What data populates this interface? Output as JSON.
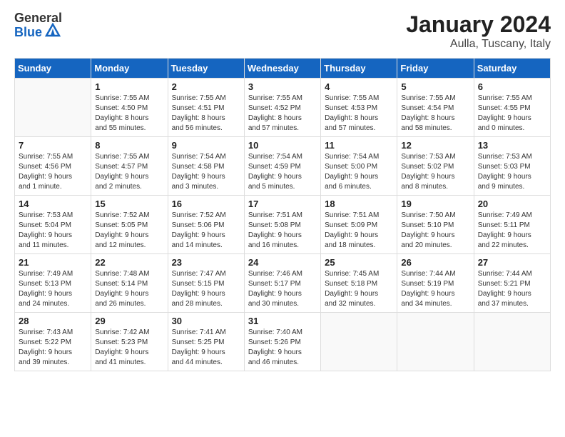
{
  "logo": {
    "general": "General",
    "blue": "Blue"
  },
  "title": "January 2024",
  "location": "Aulla, Tuscany, Italy",
  "headers": [
    "Sunday",
    "Monday",
    "Tuesday",
    "Wednesday",
    "Thursday",
    "Friday",
    "Saturday"
  ],
  "weeks": [
    [
      {
        "day": "",
        "info": ""
      },
      {
        "day": "1",
        "info": "Sunrise: 7:55 AM\nSunset: 4:50 PM\nDaylight: 8 hours\nand 55 minutes."
      },
      {
        "day": "2",
        "info": "Sunrise: 7:55 AM\nSunset: 4:51 PM\nDaylight: 8 hours\nand 56 minutes."
      },
      {
        "day": "3",
        "info": "Sunrise: 7:55 AM\nSunset: 4:52 PM\nDaylight: 8 hours\nand 57 minutes."
      },
      {
        "day": "4",
        "info": "Sunrise: 7:55 AM\nSunset: 4:53 PM\nDaylight: 8 hours\nand 57 minutes."
      },
      {
        "day": "5",
        "info": "Sunrise: 7:55 AM\nSunset: 4:54 PM\nDaylight: 8 hours\nand 58 minutes."
      },
      {
        "day": "6",
        "info": "Sunrise: 7:55 AM\nSunset: 4:55 PM\nDaylight: 9 hours\nand 0 minutes."
      }
    ],
    [
      {
        "day": "7",
        "info": "Sunrise: 7:55 AM\nSunset: 4:56 PM\nDaylight: 9 hours\nand 1 minute."
      },
      {
        "day": "8",
        "info": "Sunrise: 7:55 AM\nSunset: 4:57 PM\nDaylight: 9 hours\nand 2 minutes."
      },
      {
        "day": "9",
        "info": "Sunrise: 7:54 AM\nSunset: 4:58 PM\nDaylight: 9 hours\nand 3 minutes."
      },
      {
        "day": "10",
        "info": "Sunrise: 7:54 AM\nSunset: 4:59 PM\nDaylight: 9 hours\nand 5 minutes."
      },
      {
        "day": "11",
        "info": "Sunrise: 7:54 AM\nSunset: 5:00 PM\nDaylight: 9 hours\nand 6 minutes."
      },
      {
        "day": "12",
        "info": "Sunrise: 7:53 AM\nSunset: 5:02 PM\nDaylight: 9 hours\nand 8 minutes."
      },
      {
        "day": "13",
        "info": "Sunrise: 7:53 AM\nSunset: 5:03 PM\nDaylight: 9 hours\nand 9 minutes."
      }
    ],
    [
      {
        "day": "14",
        "info": "Sunrise: 7:53 AM\nSunset: 5:04 PM\nDaylight: 9 hours\nand 11 minutes."
      },
      {
        "day": "15",
        "info": "Sunrise: 7:52 AM\nSunset: 5:05 PM\nDaylight: 9 hours\nand 12 minutes."
      },
      {
        "day": "16",
        "info": "Sunrise: 7:52 AM\nSunset: 5:06 PM\nDaylight: 9 hours\nand 14 minutes."
      },
      {
        "day": "17",
        "info": "Sunrise: 7:51 AM\nSunset: 5:08 PM\nDaylight: 9 hours\nand 16 minutes."
      },
      {
        "day": "18",
        "info": "Sunrise: 7:51 AM\nSunset: 5:09 PM\nDaylight: 9 hours\nand 18 minutes."
      },
      {
        "day": "19",
        "info": "Sunrise: 7:50 AM\nSunset: 5:10 PM\nDaylight: 9 hours\nand 20 minutes."
      },
      {
        "day": "20",
        "info": "Sunrise: 7:49 AM\nSunset: 5:11 PM\nDaylight: 9 hours\nand 22 minutes."
      }
    ],
    [
      {
        "day": "21",
        "info": "Sunrise: 7:49 AM\nSunset: 5:13 PM\nDaylight: 9 hours\nand 24 minutes."
      },
      {
        "day": "22",
        "info": "Sunrise: 7:48 AM\nSunset: 5:14 PM\nDaylight: 9 hours\nand 26 minutes."
      },
      {
        "day": "23",
        "info": "Sunrise: 7:47 AM\nSunset: 5:15 PM\nDaylight: 9 hours\nand 28 minutes."
      },
      {
        "day": "24",
        "info": "Sunrise: 7:46 AM\nSunset: 5:17 PM\nDaylight: 9 hours\nand 30 minutes."
      },
      {
        "day": "25",
        "info": "Sunrise: 7:45 AM\nSunset: 5:18 PM\nDaylight: 9 hours\nand 32 minutes."
      },
      {
        "day": "26",
        "info": "Sunrise: 7:44 AM\nSunset: 5:19 PM\nDaylight: 9 hours\nand 34 minutes."
      },
      {
        "day": "27",
        "info": "Sunrise: 7:44 AM\nSunset: 5:21 PM\nDaylight: 9 hours\nand 37 minutes."
      }
    ],
    [
      {
        "day": "28",
        "info": "Sunrise: 7:43 AM\nSunset: 5:22 PM\nDaylight: 9 hours\nand 39 minutes."
      },
      {
        "day": "29",
        "info": "Sunrise: 7:42 AM\nSunset: 5:23 PM\nDaylight: 9 hours\nand 41 minutes."
      },
      {
        "day": "30",
        "info": "Sunrise: 7:41 AM\nSunset: 5:25 PM\nDaylight: 9 hours\nand 44 minutes."
      },
      {
        "day": "31",
        "info": "Sunrise: 7:40 AM\nSunset: 5:26 PM\nDaylight: 9 hours\nand 46 minutes."
      },
      {
        "day": "",
        "info": ""
      },
      {
        "day": "",
        "info": ""
      },
      {
        "day": "",
        "info": ""
      }
    ]
  ]
}
